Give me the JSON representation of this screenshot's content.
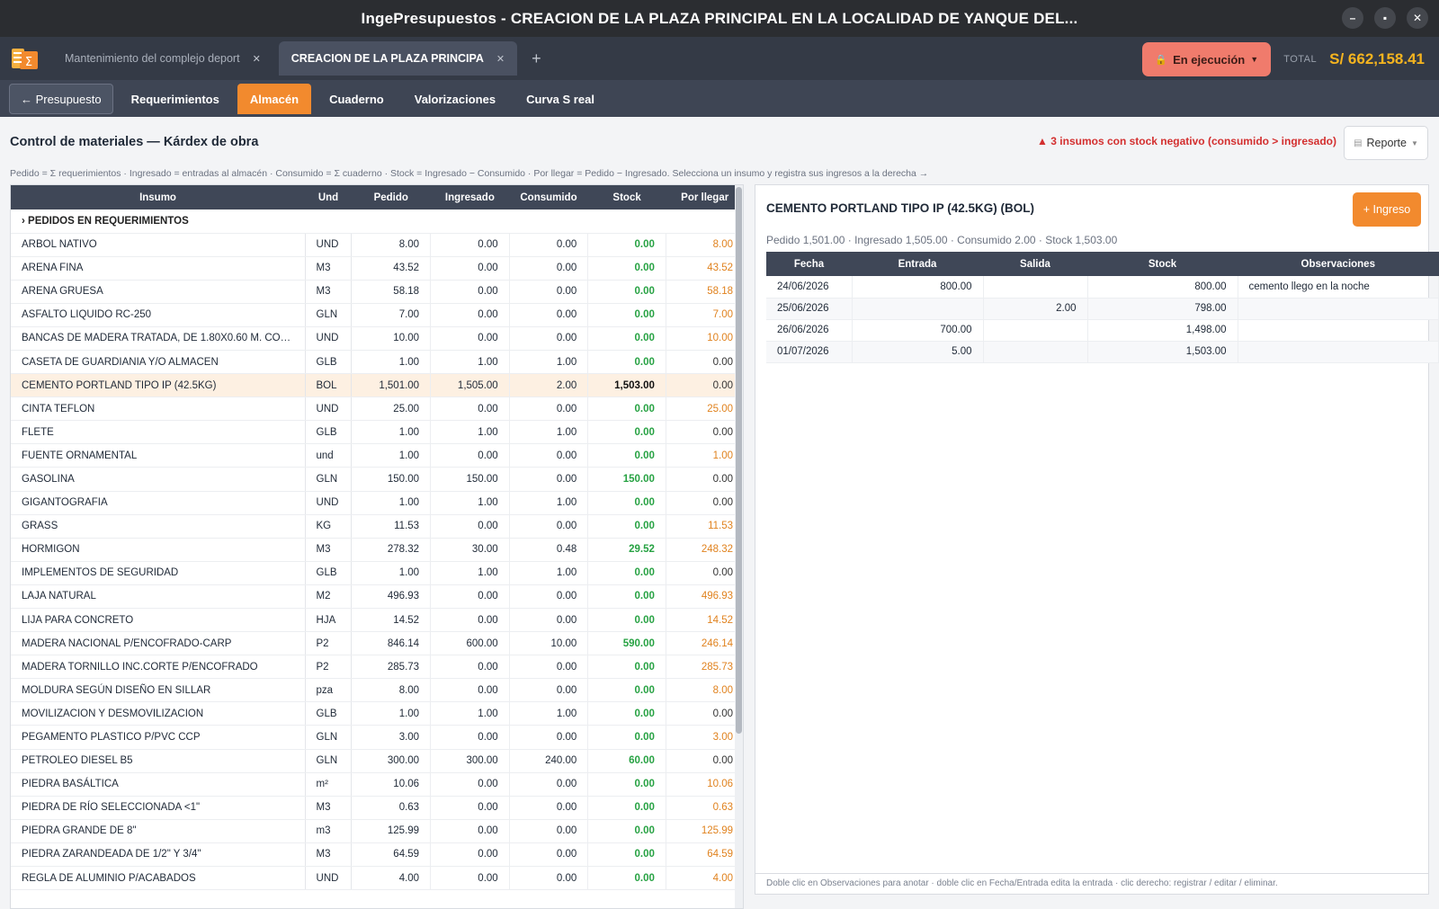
{
  "window": {
    "title": "IngePresupuestos  -  CREACION DE LA PLAZA PRINCIPAL EN LA LOCALIDAD DE YANQUE DEL..."
  },
  "tabs": [
    {
      "label": "Mantenimiento del complejo deport",
      "active": false
    },
    {
      "label": "CREACION DE LA PLAZA PRINCIPA",
      "active": true
    }
  ],
  "status": {
    "label": "En ejecución",
    "icon": "lock-icon"
  },
  "total": {
    "label": "TOTAL",
    "value": "S/ 662,158.41"
  },
  "section_tabs": {
    "back": "← Presupuesto",
    "items": [
      "Requerimientos",
      "Almacén",
      "Cuaderno",
      "Valorizaciones",
      "Curva S real"
    ],
    "active": "Almacén"
  },
  "page": {
    "title": "Control de materiales — Kárdex de obra",
    "warning": "3 insumos con stock negativo (consumido > ingresado)",
    "report_label": "Reporte",
    "hint": "Pedido = Σ requerimientos · Ingresado = entradas al almacén · Consumido = Σ cuaderno · Stock = Ingresado − Consumido · Por llegar = Pedido − Ingresado. Selecciona un insumo y registra sus ingresos a la derecha →"
  },
  "materials": {
    "headers": [
      "Insumo",
      "Und",
      "Pedido",
      "Ingresado",
      "Consumido",
      "Stock",
      "Por llegar"
    ],
    "group_label": "PEDIDOS EN REQUERIMIENTOS",
    "rows": [
      {
        "name": "ARBOL NATIVO",
        "und": "UND",
        "pedido": "8.00",
        "ingresado": "0.00",
        "consumido": "0.00",
        "stock": "0.00",
        "por": "8.00"
      },
      {
        "name": "ARENA FINA",
        "und": "M3",
        "pedido": "43.52",
        "ingresado": "0.00",
        "consumido": "0.00",
        "stock": "0.00",
        "por": "43.52"
      },
      {
        "name": "ARENA GRUESA",
        "und": "M3",
        "pedido": "58.18",
        "ingresado": "0.00",
        "consumido": "0.00",
        "stock": "0.00",
        "por": "58.18"
      },
      {
        "name": "ASFALTO LIQUIDO RC-250",
        "und": "GLN",
        "pedido": "7.00",
        "ingresado": "0.00",
        "consumido": "0.00",
        "stock": "0.00",
        "por": "7.00"
      },
      {
        "name": "BANCAS DE MADERA TRATADA, DE 1.80X0.60 M. CON PATAS",
        "und": "UND",
        "pedido": "10.00",
        "ingresado": "0.00",
        "consumido": "0.00",
        "stock": "0.00",
        "por": "10.00"
      },
      {
        "name": "CASETA DE GUARDIANIA Y/O ALMACEN",
        "und": "GLB",
        "pedido": "1.00",
        "ingresado": "1.00",
        "consumido": "1.00",
        "stock": "0.00",
        "por": "0.00"
      },
      {
        "name": "CEMENTO PORTLAND TIPO IP (42.5KG)",
        "und": "BOL",
        "pedido": "1,501.00",
        "ingresado": "1,505.00",
        "consumido": "2.00",
        "stock": "1,503.00",
        "por": "0.00",
        "selected": true
      },
      {
        "name": "CINTA TEFLON",
        "und": "UND",
        "pedido": "25.00",
        "ingresado": "0.00",
        "consumido": "0.00",
        "stock": "0.00",
        "por": "25.00"
      },
      {
        "name": "FLETE",
        "und": "GLB",
        "pedido": "1.00",
        "ingresado": "1.00",
        "consumido": "1.00",
        "stock": "0.00",
        "por": "0.00"
      },
      {
        "name": "FUENTE ORNAMENTAL",
        "und": "und",
        "pedido": "1.00",
        "ingresado": "0.00",
        "consumido": "0.00",
        "stock": "0.00",
        "por": "1.00"
      },
      {
        "name": "GASOLINA",
        "und": "GLN",
        "pedido": "150.00",
        "ingresado": "150.00",
        "consumido": "0.00",
        "stock": "150.00",
        "por": "0.00"
      },
      {
        "name": "GIGANTOGRAFIA",
        "und": "UND",
        "pedido": "1.00",
        "ingresado": "1.00",
        "consumido": "1.00",
        "stock": "0.00",
        "por": "0.00"
      },
      {
        "name": "GRASS",
        "und": "KG",
        "pedido": "11.53",
        "ingresado": "0.00",
        "consumido": "0.00",
        "stock": "0.00",
        "por": "11.53"
      },
      {
        "name": "HORMIGON",
        "und": "M3",
        "pedido": "278.32",
        "ingresado": "30.00",
        "consumido": "0.48",
        "stock": "29.52",
        "por": "248.32"
      },
      {
        "name": "IMPLEMENTOS DE SEGURIDAD",
        "und": "GLB",
        "pedido": "1.00",
        "ingresado": "1.00",
        "consumido": "1.00",
        "stock": "0.00",
        "por": "0.00"
      },
      {
        "name": "LAJA NATURAL",
        "und": "M2",
        "pedido": "496.93",
        "ingresado": "0.00",
        "consumido": "0.00",
        "stock": "0.00",
        "por": "496.93"
      },
      {
        "name": "LIJA PARA CONCRETO",
        "und": "HJA",
        "pedido": "14.52",
        "ingresado": "0.00",
        "consumido": "0.00",
        "stock": "0.00",
        "por": "14.52"
      },
      {
        "name": "MADERA NACIONAL P/ENCOFRADO-CARP",
        "und": "P2",
        "pedido": "846.14",
        "ingresado": "600.00",
        "consumido": "10.00",
        "stock": "590.00",
        "por": "246.14"
      },
      {
        "name": "MADERA TORNILLO INC.CORTE P/ENCOFRADO",
        "und": "P2",
        "pedido": "285.73",
        "ingresado": "0.00",
        "consumido": "0.00",
        "stock": "0.00",
        "por": "285.73"
      },
      {
        "name": "MOLDURA SEGÚN DISEÑO EN SILLAR",
        "und": "pza",
        "pedido": "8.00",
        "ingresado": "0.00",
        "consumido": "0.00",
        "stock": "0.00",
        "por": "8.00"
      },
      {
        "name": "MOVILIZACION Y DESMOVILIZACION",
        "und": "GLB",
        "pedido": "1.00",
        "ingresado": "1.00",
        "consumido": "1.00",
        "stock": "0.00",
        "por": "0.00"
      },
      {
        "name": "PEGAMENTO PLASTICO P/PVC CCP",
        "und": "GLN",
        "pedido": "3.00",
        "ingresado": "0.00",
        "consumido": "0.00",
        "stock": "0.00",
        "por": "3.00"
      },
      {
        "name": "PETROLEO DIESEL B5",
        "und": "GLN",
        "pedido": "300.00",
        "ingresado": "300.00",
        "consumido": "240.00",
        "stock": "60.00",
        "por": "0.00"
      },
      {
        "name": "PIEDRA BASÁLTICA",
        "und": "m²",
        "pedido": "10.06",
        "ingresado": "0.00",
        "consumido": "0.00",
        "stock": "0.00",
        "por": "10.06"
      },
      {
        "name": "PIEDRA DE RÍO SELECCIONADA <1\"",
        "und": "M3",
        "pedido": "0.63",
        "ingresado": "0.00",
        "consumido": "0.00",
        "stock": "0.00",
        "por": "0.63"
      },
      {
        "name": "PIEDRA GRANDE DE 8\"",
        "und": "m3",
        "pedido": "125.99",
        "ingresado": "0.00",
        "consumido": "0.00",
        "stock": "0.00",
        "por": "125.99"
      },
      {
        "name": "PIEDRA ZARANDEADA DE 1/2\" Y 3/4\"",
        "und": "M3",
        "pedido": "64.59",
        "ingresado": "0.00",
        "consumido": "0.00",
        "stock": "0.00",
        "por": "64.59"
      },
      {
        "name": "REGLA DE ALUMINIO P/ACABADOS",
        "und": "UND",
        "pedido": "4.00",
        "ingresado": "0.00",
        "consumido": "0.00",
        "stock": "0.00",
        "por": "4.00"
      }
    ]
  },
  "detail": {
    "title": "CEMENTO PORTLAND TIPO IP (42.5KG)  (BOL)",
    "ingreso_label": "+ Ingreso",
    "summary": "Pedido 1,501.00 · Ingresado 1,505.00 · Consumido 2.00 · Stock 1,503.00",
    "headers": [
      "Fecha",
      "Entrada",
      "Salida",
      "Stock",
      "Observaciones"
    ],
    "rows": [
      {
        "fecha": "24/06/2026",
        "entrada": "800.00",
        "salida": "",
        "stock": "800.00",
        "obs": "cemento llego en la noche"
      },
      {
        "fecha": "25/06/2026",
        "entrada": "",
        "salida": "2.00",
        "stock": "798.00",
        "obs": ""
      },
      {
        "fecha": "26/06/2026",
        "entrada": "700.00",
        "salida": "",
        "stock": "1,498.00",
        "obs": ""
      },
      {
        "fecha": "01/07/2026",
        "entrada": "5.00",
        "salida": "",
        "stock": "1,503.00",
        "obs": ""
      }
    ],
    "footer": "Doble clic en Observaciones para anotar · doble clic en Fecha/Entrada edita la entrada · clic derecho: registrar / editar / eliminar."
  },
  "colors": {
    "accent": "#f28a2e",
    "status": "#f07b6c",
    "total": "#f5b41f",
    "stock_green": "#27a243",
    "por_llegar": "#e0821e",
    "warning": "#d32f2f"
  }
}
